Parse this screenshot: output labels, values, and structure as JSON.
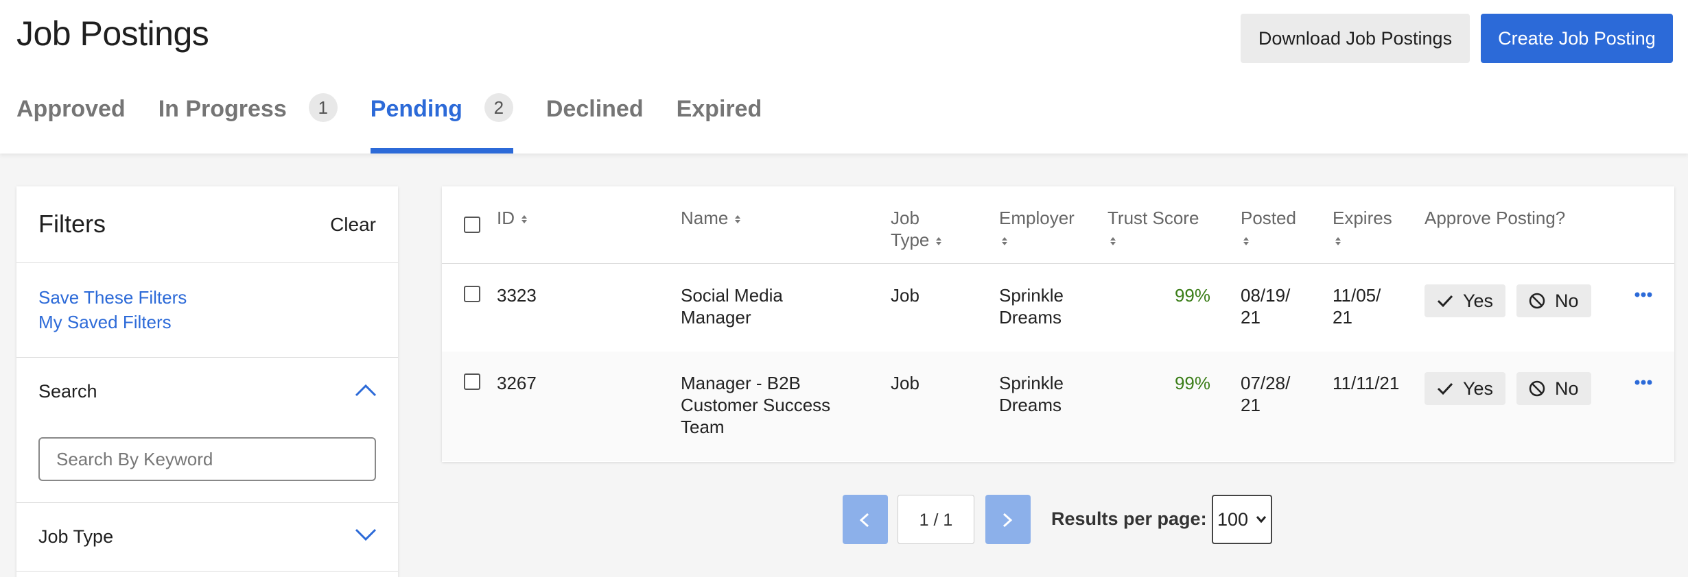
{
  "page": {
    "title": "Job Postings",
    "download_label": "Download Job Postings",
    "create_label": "Create Job Posting"
  },
  "tabs": [
    {
      "label": "Approved",
      "count": null,
      "active": false
    },
    {
      "label": "In Progress",
      "count": "1",
      "active": false
    },
    {
      "label": "Pending",
      "count": "2",
      "active": true
    },
    {
      "label": "Declined",
      "count": null,
      "active": false
    },
    {
      "label": "Expired",
      "count": null,
      "active": false
    }
  ],
  "filters": {
    "title": "Filters",
    "clear_label": "Clear",
    "save_link": "Save These Filters",
    "saved_link": "My Saved Filters",
    "search_label": "Search",
    "search_placeholder": "Search By Keyword",
    "job_type_label": "Job Type"
  },
  "table": {
    "headers": {
      "id": "ID",
      "name": "Name",
      "job_type": [
        "Job",
        "Type"
      ],
      "employer": "Employer",
      "trust_score": "Trust Score",
      "posted": "Posted",
      "expires": "Expires",
      "approve": "Approve Posting?"
    },
    "yes_label": "Yes",
    "no_label": "No",
    "rows": [
      {
        "id": "3323",
        "name": [
          "Social Media",
          "Manager"
        ],
        "job_type": "Job",
        "employer": [
          "Sprinkle",
          "Dreams"
        ],
        "trust_score": "99%",
        "posted": [
          "08/19/",
          "21"
        ],
        "expires": [
          "11/05/",
          "21"
        ]
      },
      {
        "id": "3267",
        "name": [
          "Manager - B2B",
          "Customer Success",
          "Team"
        ],
        "job_type": "Job",
        "employer": [
          "Sprinkle",
          "Dreams"
        ],
        "trust_score": "99%",
        "posted": [
          "07/28/",
          "21"
        ],
        "expires": [
          "11/11/21"
        ]
      }
    ]
  },
  "pagination": {
    "page_count": "1 / 1",
    "results_label": "Results per page:",
    "results_value": "100"
  },
  "colors": {
    "accent": "#2c6ad8",
    "trust_green": "#3a7d17",
    "pager_button": "#8cb0ea"
  }
}
